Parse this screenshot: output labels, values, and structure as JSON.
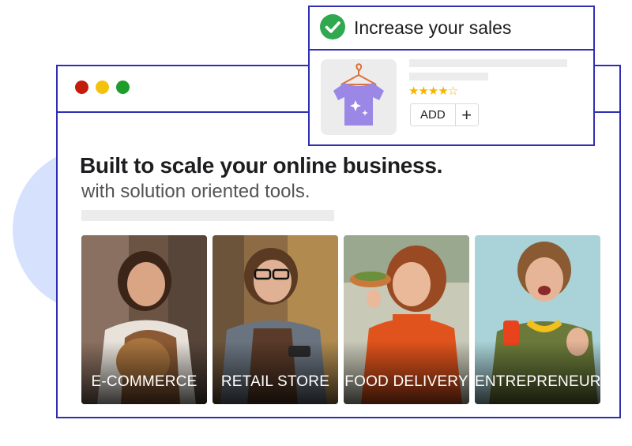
{
  "popup": {
    "title": "Increase your sales",
    "rating_full": "★★★★",
    "rating_empty": "☆",
    "add_label": "ADD",
    "plus_label": "+",
    "icon": "check-circle-icon"
  },
  "hero": {
    "headline": "Built to scale your online business.",
    "subline": "with solution oriented tools."
  },
  "cards": [
    {
      "label": "E-COMMERCE"
    },
    {
      "label": "RETAIL STORE"
    },
    {
      "label": "FOOD DELIVERY"
    },
    {
      "label": "ENTREPRENEUR"
    }
  ],
  "colors": {
    "accent_border": "#2f2fb6",
    "dot_red": "#c41c0c",
    "dot_yellow": "#f4c20d",
    "dot_green": "#1f9d2a",
    "check_green": "#2fa84f",
    "star": "#f5b400",
    "shirt": "#9b87e6"
  }
}
